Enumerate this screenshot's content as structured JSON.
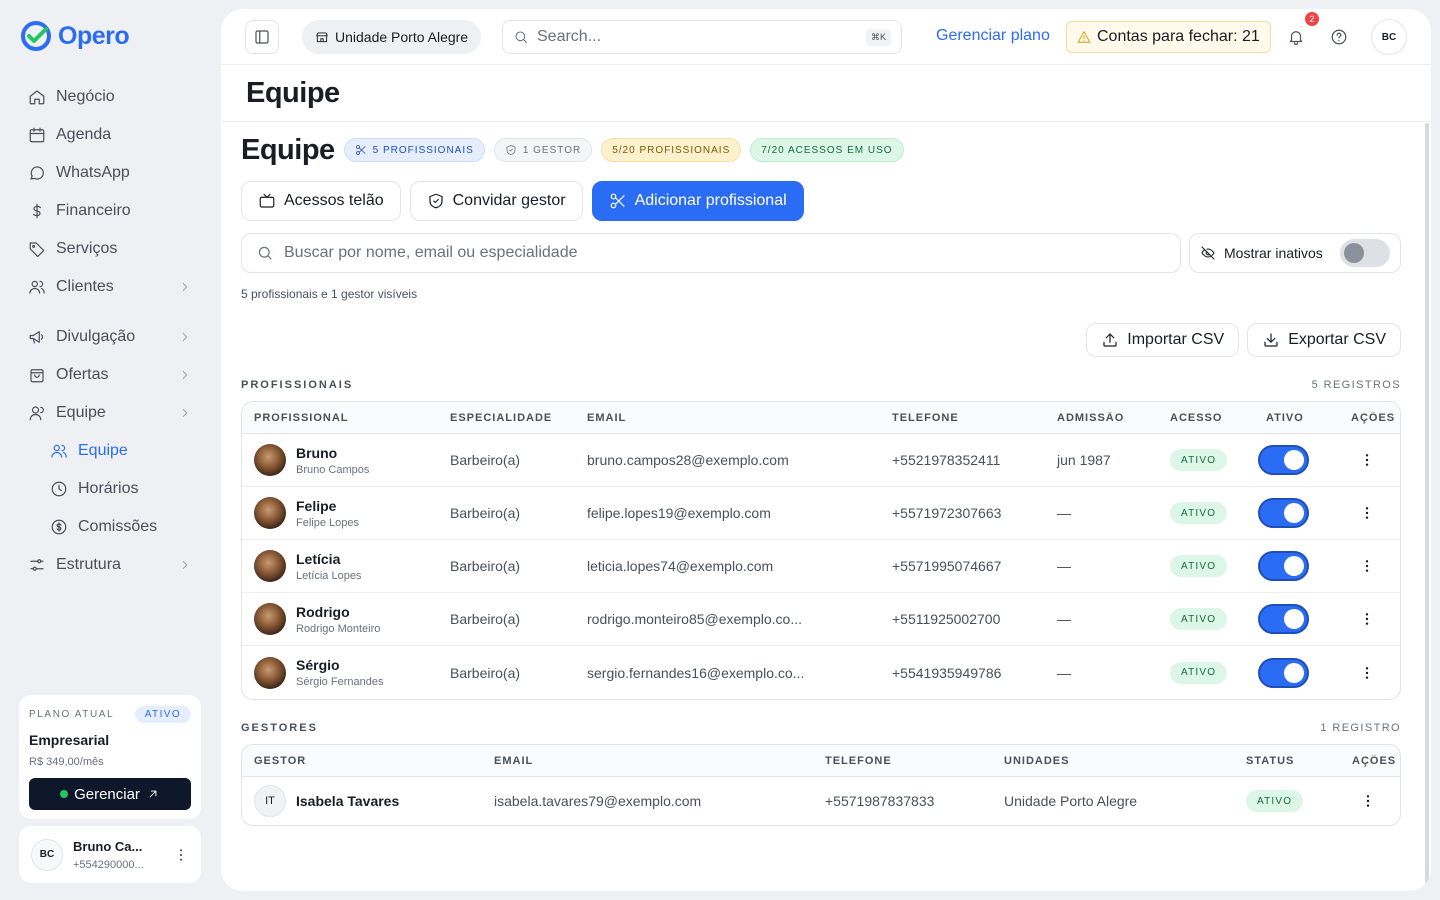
{
  "app": {
    "name": "Opero"
  },
  "sidebar": {
    "items": [
      {
        "label": "Negócio"
      },
      {
        "label": "Agenda"
      },
      {
        "label": "WhatsApp"
      },
      {
        "label": "Financeiro"
      },
      {
        "label": "Serviços"
      },
      {
        "label": "Clientes"
      },
      {
        "label": "Divulgação"
      },
      {
        "label": "Ofertas"
      },
      {
        "label": "Equipe"
      },
      {
        "label": "Equipe"
      },
      {
        "label": "Horários"
      },
      {
        "label": "Comissões"
      },
      {
        "label": "Estrutura"
      }
    ],
    "plan": {
      "label": "PLANO ATUAL",
      "badge": "ATIVO",
      "name": "Empresarial",
      "price": "R$ 349,00/mês",
      "button": "Gerenciar"
    },
    "user": {
      "initials": "BC",
      "name": "Bruno Ca...",
      "phone": "+554290000..."
    }
  },
  "topbar": {
    "unit": "Unidade Porto Alegre",
    "search_placeholder": "Search...",
    "shortcut": "⌘K",
    "plan_link": "Gerenciar plano",
    "contas": "Contas para fechar: 21",
    "notif_count": "2",
    "avatar": "BC"
  },
  "page": {
    "title": "Equipe",
    "heading": "Equipe",
    "pills": [
      "5 PROFISSIONAIS",
      "1 GESTOR",
      "5/20 PROFISSIONAIS",
      "7/20 ACESSOS EM USO"
    ],
    "buttons": {
      "telao": "Acessos telão",
      "convidar": "Convidar gestor",
      "adicionar": "Adicionar profissional"
    },
    "search_placeholder": "Buscar por nome, email ou especialidade",
    "show_inactive": "Mostrar inativos",
    "visible_note": "5 profissionais e 1 gestor visíveis",
    "import": "Importar CSV",
    "export": "Exportar CSV"
  },
  "profissionais": {
    "label": "PROFISSIONAIS",
    "count": "5 REGISTROS",
    "columns": [
      "PROFISSIONAL",
      "ESPECIALIDADE",
      "EMAIL",
      "TELEFONE",
      "ADMISSÃO",
      "ACESSO",
      "ATIVO",
      "AÇÕES"
    ],
    "rows": [
      {
        "name": "Bruno",
        "full": "Bruno Campos",
        "spec": "Barbeiro(a)",
        "email": "bruno.campos28@exemplo.com",
        "phone": "+5521978352411",
        "admission": "jun 1987",
        "access": "ATIVO"
      },
      {
        "name": "Felipe",
        "full": "Felipe Lopes",
        "spec": "Barbeiro(a)",
        "email": "felipe.lopes19@exemplo.com",
        "phone": "+5571972307663",
        "admission": "—",
        "access": "ATIVO"
      },
      {
        "name": "Letícia",
        "full": "Letícia Lopes",
        "spec": "Barbeiro(a)",
        "email": "leticia.lopes74@exemplo.com",
        "phone": "+5571995074667",
        "admission": "—",
        "access": "ATIVO"
      },
      {
        "name": "Rodrigo",
        "full": "Rodrigo Monteiro",
        "spec": "Barbeiro(a)",
        "email": "rodrigo.monteiro85@exemplo.co...",
        "phone": "+5511925002700",
        "admission": "—",
        "access": "ATIVO"
      },
      {
        "name": "Sérgio",
        "full": "Sérgio Fernandes",
        "spec": "Barbeiro(a)",
        "email": "sergio.fernandes16@exemplo.co...",
        "phone": "+5541935949786",
        "admission": "—",
        "access": "ATIVO"
      }
    ]
  },
  "gestores": {
    "label": "GESTORES",
    "count": "1 REGISTRO",
    "columns": [
      "GESTOR",
      "EMAIL",
      "TELEFONE",
      "UNIDADES",
      "STATUS",
      "AÇÕES"
    ],
    "rows": [
      {
        "initials": "IT",
        "name": "Isabela Tavares",
        "email": "isabela.tavares79@exemplo.com",
        "phone": "+5571987837833",
        "unit": "Unidade Porto Alegre",
        "status": "ATIVO"
      }
    ]
  },
  "colors": {
    "accent": "#2a6df4",
    "success": "#22c55e",
    "warning": "#d99a06"
  }
}
